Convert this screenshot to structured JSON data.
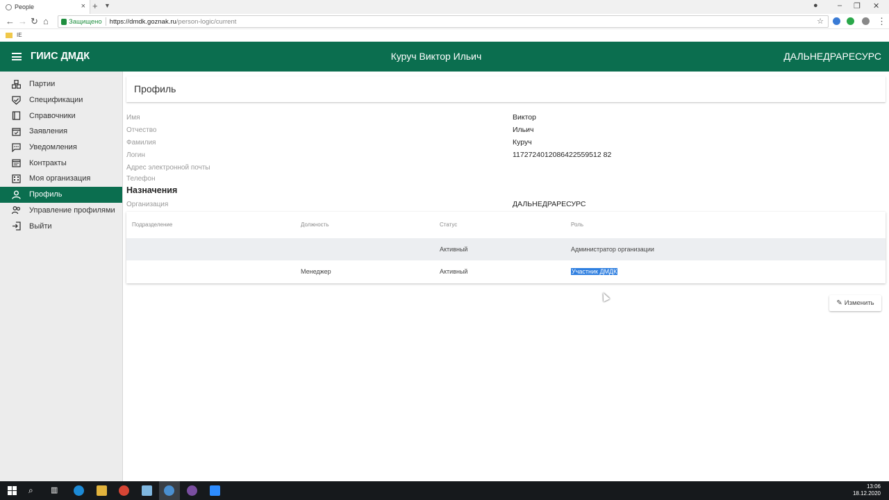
{
  "browser": {
    "tab_title": "People",
    "address": {
      "secure_label": "Защищено",
      "url_host": "https://dmdk.goznak.ru",
      "url_path": "/person-logic/current"
    },
    "bookmarks": [
      {
        "label": "IE"
      }
    ]
  },
  "header": {
    "app_title": "ГИИС ДМДК",
    "user_name": "Куруч Виктор Ильич",
    "org_name": "ДАЛЬНЕДРАРЕСУРС",
    "color": "#0b6e4f"
  },
  "sidebar": {
    "items": [
      {
        "label": "Партии",
        "icon": "parcels-icon"
      },
      {
        "label": "Спецификации",
        "icon": "shield-check-icon"
      },
      {
        "label": "Справочники",
        "icon": "book-icon"
      },
      {
        "label": "Заявления",
        "icon": "calendar-check-icon"
      },
      {
        "label": "Уведомления",
        "icon": "chat-icon"
      },
      {
        "label": "Контракты",
        "icon": "calendar-icon"
      },
      {
        "label": "Моя организация",
        "icon": "building-icon"
      },
      {
        "label": "Профиль",
        "icon": "person-icon",
        "active": true
      },
      {
        "label": "Управление профилями",
        "icon": "people-icon"
      },
      {
        "label": "Выйти",
        "icon": "logout-icon"
      }
    ]
  },
  "profile": {
    "title": "Профиль",
    "fields": [
      {
        "label": "Имя",
        "value": "Виктор"
      },
      {
        "label": "Отчество",
        "value": "Ильич"
      },
      {
        "label": "Фамилия",
        "value": "Куруч"
      },
      {
        "label": "Логин",
        "value": "1172724012086422559512 82"
      },
      {
        "label": "Адрес электронной почты",
        "value": ""
      },
      {
        "label": "Телефон",
        "value": ""
      }
    ]
  },
  "assignments": {
    "title": "Назначения",
    "org_label": "Организация",
    "org_value": "ДАЛЬНЕДРАРЕСУРС",
    "columns": [
      "Подразделение",
      "Должность",
      "Статус",
      "Роль"
    ],
    "rows": [
      {
        "department": "",
        "position": "",
        "status": "Активный",
        "role": "Администратор организации"
      },
      {
        "department": "",
        "position": "Менеджер",
        "status": "Активный",
        "role": "Участник ДМДК"
      }
    ]
  },
  "actions": {
    "edit_label": "Изменить"
  },
  "taskbar": {
    "time": "13:06",
    "date": "18.12.2020"
  }
}
